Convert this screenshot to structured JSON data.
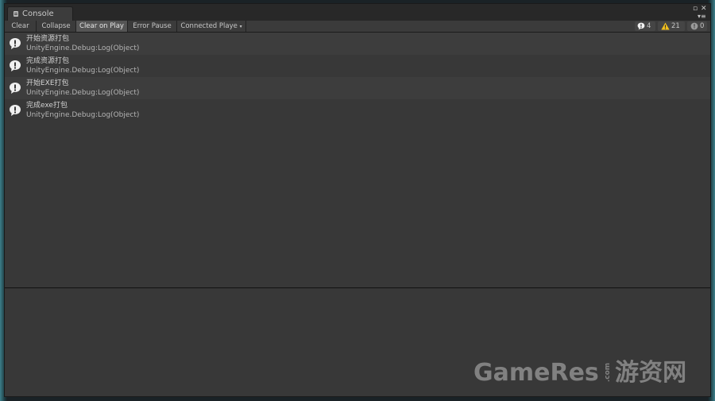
{
  "window": {
    "tab_title": "Console",
    "tab_icon": "console-icon"
  },
  "toolbar": {
    "clear": "Clear",
    "collapse": "Collapse",
    "clear_on_play": "Clear on Play",
    "error_pause": "Error Pause",
    "connected_player": "Connected Playe"
  },
  "counts": {
    "info": "4",
    "warning": "21",
    "error": "0"
  },
  "logs": [
    {
      "message": "开始资源打包",
      "trace": "UnityEngine.Debug:Log(Object)",
      "icon": "info-icon"
    },
    {
      "message": "完成资源打包",
      "trace": "UnityEngine.Debug:Log(Object)",
      "icon": "info-icon"
    },
    {
      "message": "开始EXE打包",
      "trace": "UnityEngine.Debug:Log(Object)",
      "icon": "info-icon"
    },
    {
      "message": "完成exe打包",
      "trace": "UnityEngine.Debug:Log(Object)",
      "icon": "info-icon"
    }
  ],
  "watermark": {
    "brand": "GameRes",
    "com": ".com",
    "cn": "游资网"
  },
  "colors": {
    "accent_teal": "#3d7f8a",
    "panel_bg": "#383838",
    "warning_yellow": "#f2c01e"
  }
}
